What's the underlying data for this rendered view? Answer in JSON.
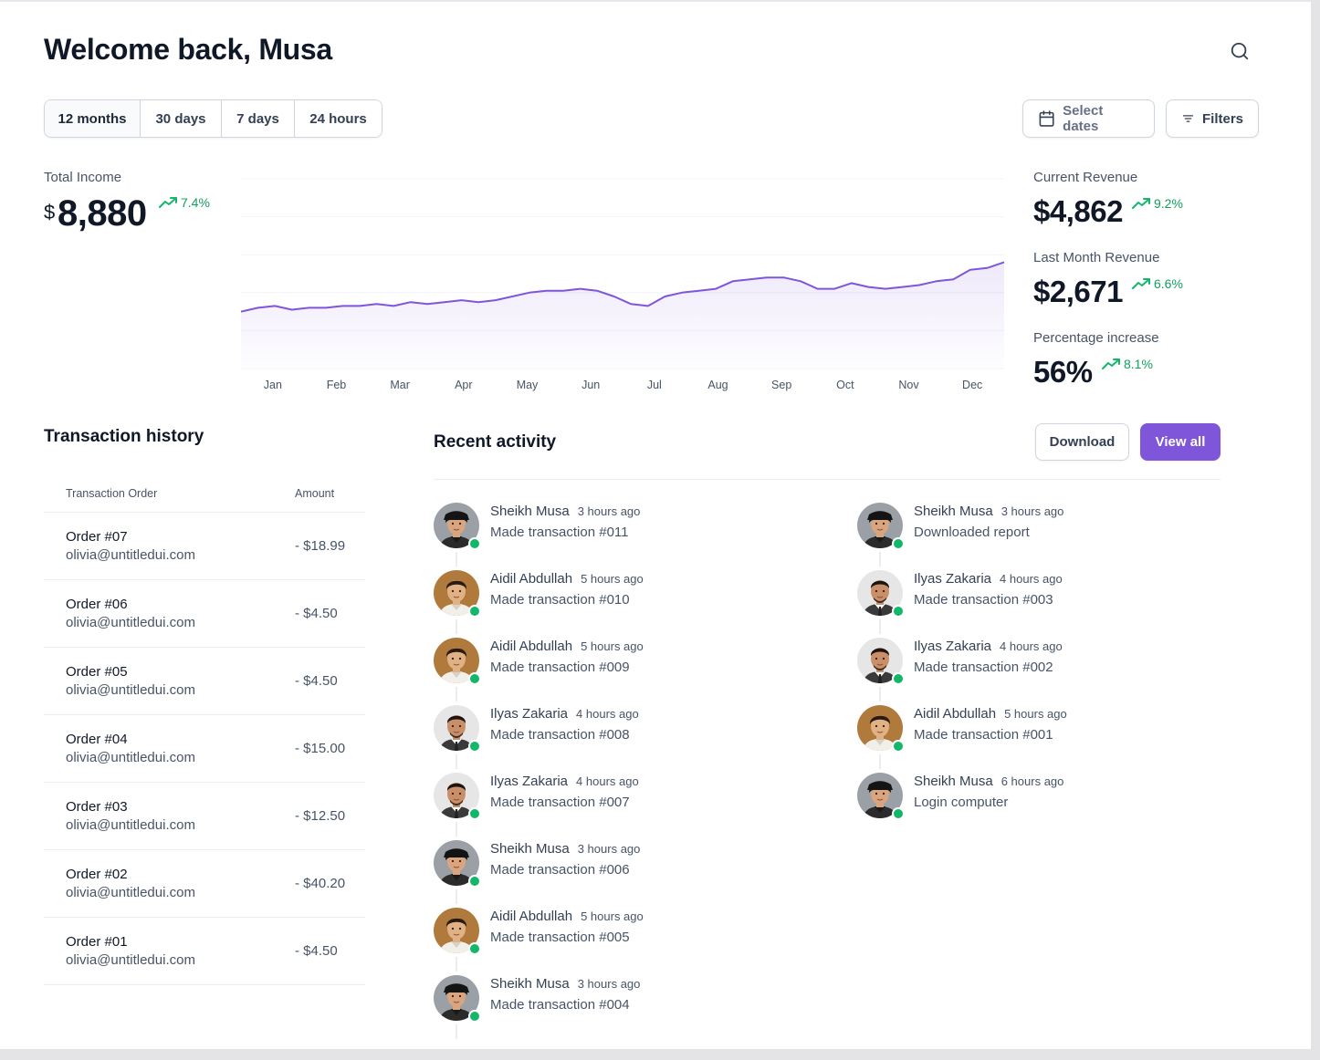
{
  "header": {
    "title": "Welcome back, Musa"
  },
  "ranges": [
    "12 months",
    "30 days",
    "7 days",
    "24 hours"
  ],
  "buttons": {
    "select_dates": "Select dates",
    "filters": "Filters",
    "download": "Download",
    "view_all": "View all"
  },
  "total_income": {
    "label": "Total Income",
    "currency": "$",
    "value": "8,880",
    "trend": "7.4%"
  },
  "stats": [
    {
      "label": "Current Revenue",
      "value": "$4,862",
      "trend": "9.2%"
    },
    {
      "label": "Last Month Revenue",
      "value": "$2,671",
      "trend": "6.6%"
    },
    {
      "label": "Percentage increase",
      "value": "56%",
      "trend": "8.1%"
    }
  ],
  "chart_data": {
    "type": "area",
    "categories": [
      "Jan",
      "Feb",
      "Mar",
      "Apr",
      "May",
      "Jun",
      "Jul",
      "Aug",
      "Sep",
      "Oct",
      "Nov",
      "Dec"
    ],
    "values": [
      30,
      32,
      33,
      31,
      32,
      32,
      33,
      33,
      34,
      33,
      35,
      34,
      35,
      36,
      35,
      36,
      38,
      40,
      41,
      41,
      42,
      41,
      38,
      34,
      33,
      38,
      40,
      41,
      42,
      46,
      47,
      48,
      48,
      46,
      42,
      42,
      45,
      43,
      42,
      43,
      44,
      46,
      47,
      52,
      53,
      56
    ],
    "ylim": [
      0,
      100
    ],
    "color": "#7f56d9",
    "grid": true
  },
  "transactions": {
    "title": "Transaction history",
    "columns": [
      "Transaction Order",
      "Amount"
    ],
    "rows": [
      {
        "order": "Order #07",
        "email": "olivia@untitledui.com",
        "amount": "- $18.99"
      },
      {
        "order": "Order #06",
        "email": "olivia@untitledui.com",
        "amount": "- $4.50"
      },
      {
        "order": "Order #05",
        "email": "olivia@untitledui.com",
        "amount": "- $4.50"
      },
      {
        "order": "Order #04",
        "email": "olivia@untitledui.com",
        "amount": "- $15.00"
      },
      {
        "order": "Order #03",
        "email": "olivia@untitledui.com",
        "amount": "- $12.50"
      },
      {
        "order": "Order #02",
        "email": "olivia@untitledui.com",
        "amount": "- $40.20"
      },
      {
        "order": "Order #01",
        "email": "olivia@untitledui.com",
        "amount": "- $4.50"
      }
    ]
  },
  "activity": {
    "title": "Recent activity",
    "left": [
      {
        "name": "Sheikh Musa",
        "time": "3 hours ago",
        "action": "Made transaction #011",
        "avatar": "sheikh"
      },
      {
        "name": "Aidil Abdullah",
        "time": "5 hours ago",
        "action": "Made transaction #010",
        "avatar": "aidil"
      },
      {
        "name": "Aidil Abdullah",
        "time": "5 hours ago",
        "action": "Made transaction #009",
        "avatar": "aidil"
      },
      {
        "name": "Ilyas Zakaria",
        "time": "4 hours ago",
        "action": "Made transaction #008",
        "avatar": "ilyas"
      },
      {
        "name": "Ilyas Zakaria",
        "time": "4 hours ago",
        "action": "Made transaction #007",
        "avatar": "ilyas"
      },
      {
        "name": "Sheikh Musa",
        "time": "3 hours ago",
        "action": "Made transaction #006",
        "avatar": "sheikh"
      },
      {
        "name": "Aidil Abdullah",
        "time": "5 hours ago",
        "action": "Made transaction #005",
        "avatar": "aidil"
      },
      {
        "name": "Sheikh Musa",
        "time": "3 hours ago",
        "action": "Made transaction #004",
        "avatar": "sheikh"
      }
    ],
    "right": [
      {
        "name": "Sheikh Musa",
        "time": "3 hours ago",
        "action": "Downloaded report",
        "avatar": "sheikh"
      },
      {
        "name": "Ilyas Zakaria",
        "time": "4 hours ago",
        "action": "Made transaction #003",
        "avatar": "ilyas"
      },
      {
        "name": "Ilyas Zakaria",
        "time": "4 hours ago",
        "action": "Made transaction #002",
        "avatar": "ilyas"
      },
      {
        "name": "Aidil Abdullah",
        "time": "5 hours ago",
        "action": "Made transaction #001",
        "avatar": "aidil"
      },
      {
        "name": "Sheikh Musa",
        "time": "6 hours ago",
        "action": "Login computer",
        "avatar": "sheikh"
      }
    ]
  }
}
